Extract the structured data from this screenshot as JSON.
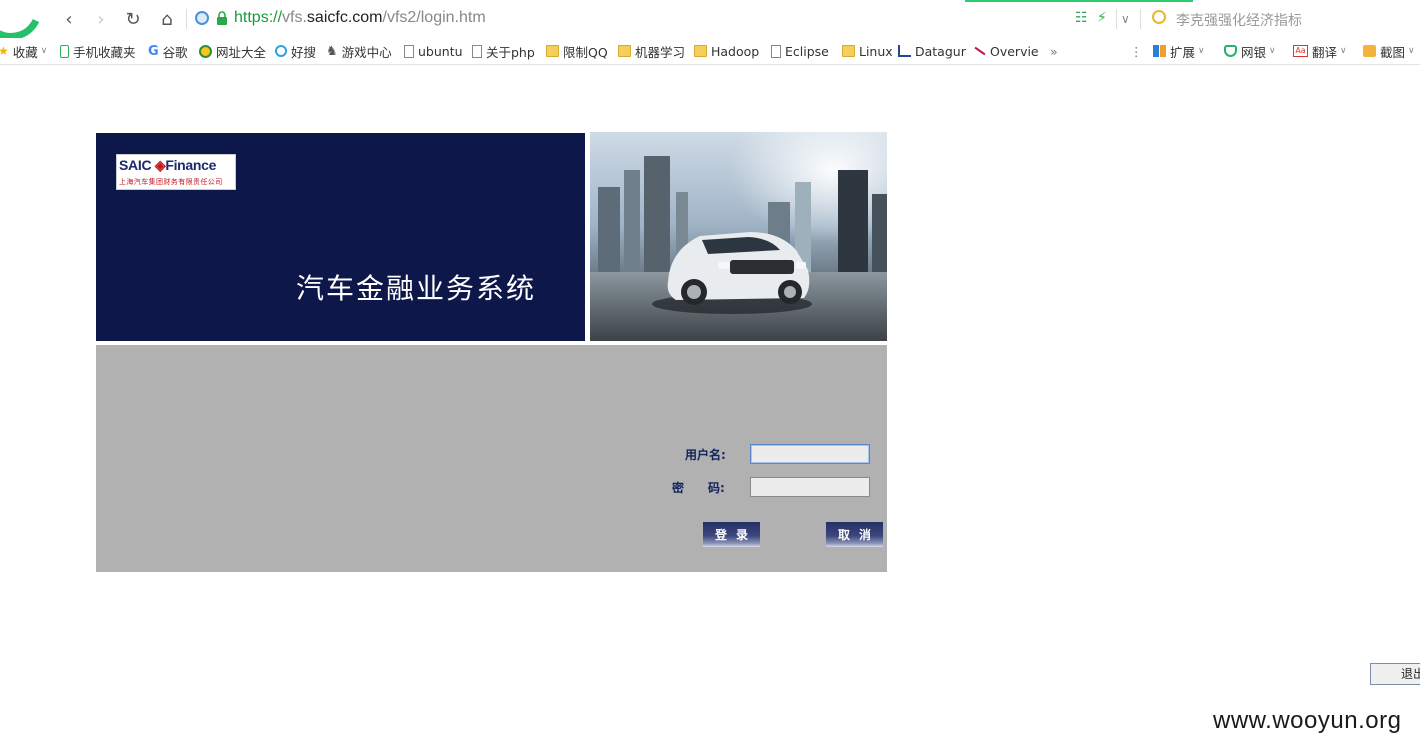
{
  "browser": {
    "url": {
      "scheme": "https://",
      "subdomain": "vfs.",
      "host": "saicfc.com",
      "path": "/vfs2/login.htm"
    },
    "search_hint": "李克强强化经济指标",
    "bookmarks": [
      {
        "label": "收藏",
        "icon": "star-icon"
      },
      {
        "label": "手机收藏夹",
        "icon": "phone-icon"
      },
      {
        "label": "谷歌",
        "icon": "google-icon"
      },
      {
        "label": "网址大全",
        "icon": "circle-icon"
      },
      {
        "label": "好搜",
        "icon": "search-icon"
      },
      {
        "label": "游戏中心",
        "icon": "gamepad-icon"
      },
      {
        "label": "ubuntu",
        "icon": "page-icon"
      },
      {
        "label": "关于php",
        "icon": "page-icon"
      },
      {
        "label": "限制QQ",
        "icon": "folder-icon"
      },
      {
        "label": "机器学习",
        "icon": "folder-icon"
      },
      {
        "label": "Hadoop",
        "icon": "folder-icon"
      },
      {
        "label": "Eclipse",
        "icon": "page-icon"
      },
      {
        "label": "Linux",
        "icon": "folder-icon"
      },
      {
        "label": "Datagur",
        "icon": "chart-icon"
      },
      {
        "label": "Overvie",
        "icon": "slash-icon"
      }
    ],
    "more_label": "»",
    "extensions": [
      {
        "label": "扩展",
        "icon": "grid-icon"
      },
      {
        "label": "网银",
        "icon": "shield-icon"
      },
      {
        "label": "翻译",
        "icon": "translate-icon"
      },
      {
        "label": "截图",
        "icon": "scissors-icon"
      }
    ]
  },
  "login": {
    "logo_brand": "SAIC",
    "logo_name": "Finance",
    "logo_subtitle": "上海汽车集团财务有限责任公司",
    "system_title": "汽车金融业务系统",
    "username_label": "用户名:",
    "password_label": "密　　码:",
    "username_value": "",
    "password_value": "",
    "login_button": "登录",
    "cancel_button": "取消"
  },
  "exit_button": "退出",
  "watermark": "www.wooyun.org"
}
